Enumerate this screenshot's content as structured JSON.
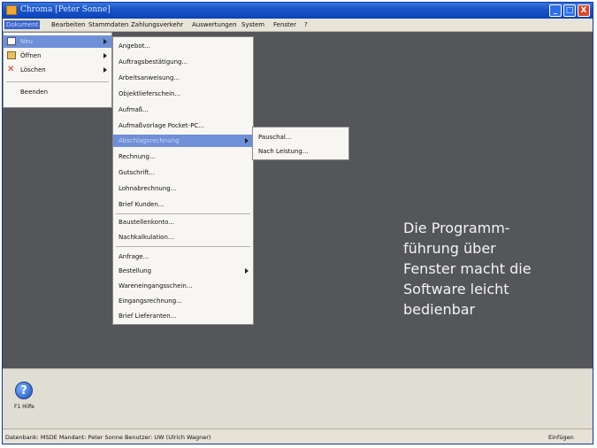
{
  "window": {
    "title": "Chroma [Peter Sonne]",
    "controls": {
      "minimize": "_",
      "maximize": "□",
      "close": "X"
    }
  },
  "menubar": [
    "Dokument",
    "Bearbeiten",
    "Stammdaten",
    "Zahlungsverkehr",
    "Auswertungen",
    "System",
    "Fenster",
    "?"
  ],
  "dokument_menu": [
    {
      "label": "Neu",
      "icon": "new-document-icon",
      "submenu": true
    },
    {
      "label": "Öffnen",
      "icon": "open-folder-icon",
      "submenu": true
    },
    {
      "label": "Löschen",
      "icon": "delete-icon",
      "submenu": true
    },
    {
      "label": "Beenden"
    }
  ],
  "neu_menu": {
    "group1": [
      "Angebot...",
      "Auftragsbestätigung...",
      "Arbeitsanweisung...",
      "Objektlieferschein...",
      "Aufmaß...",
      "Aufmaßvorlage Pocket-PC...",
      "Abschlagsrechnung",
      "Rechnung...",
      "Gutschrift...",
      "Lohnabrechnung...",
      "Brief Kunden..."
    ],
    "group2": [
      "Baustellenkonto...",
      "Nachkalkulation..."
    ],
    "group3": [
      "Anfrage...",
      "Bestellung",
      "Wareneingangsschein...",
      "Eingangsrechnung...",
      "Brief Lieferanten..."
    ]
  },
  "abschlag_menu": [
    "Pauschal...",
    "Nach Leistung..."
  ],
  "promo": {
    "line1": "Die Programm-",
    "line2": "führung über",
    "line3": "Fenster macht die",
    "line4": "Software leicht",
    "line5": "bedienbar"
  },
  "bottom": {
    "help_glyph": "?",
    "help_label": "F1 Hilfe"
  },
  "statusbar": {
    "text": "Datenbank: MSDE Mandant: Peter Sonne Benutzer: UW (Ulrich Wagner)",
    "mode": "Einfügen"
  }
}
